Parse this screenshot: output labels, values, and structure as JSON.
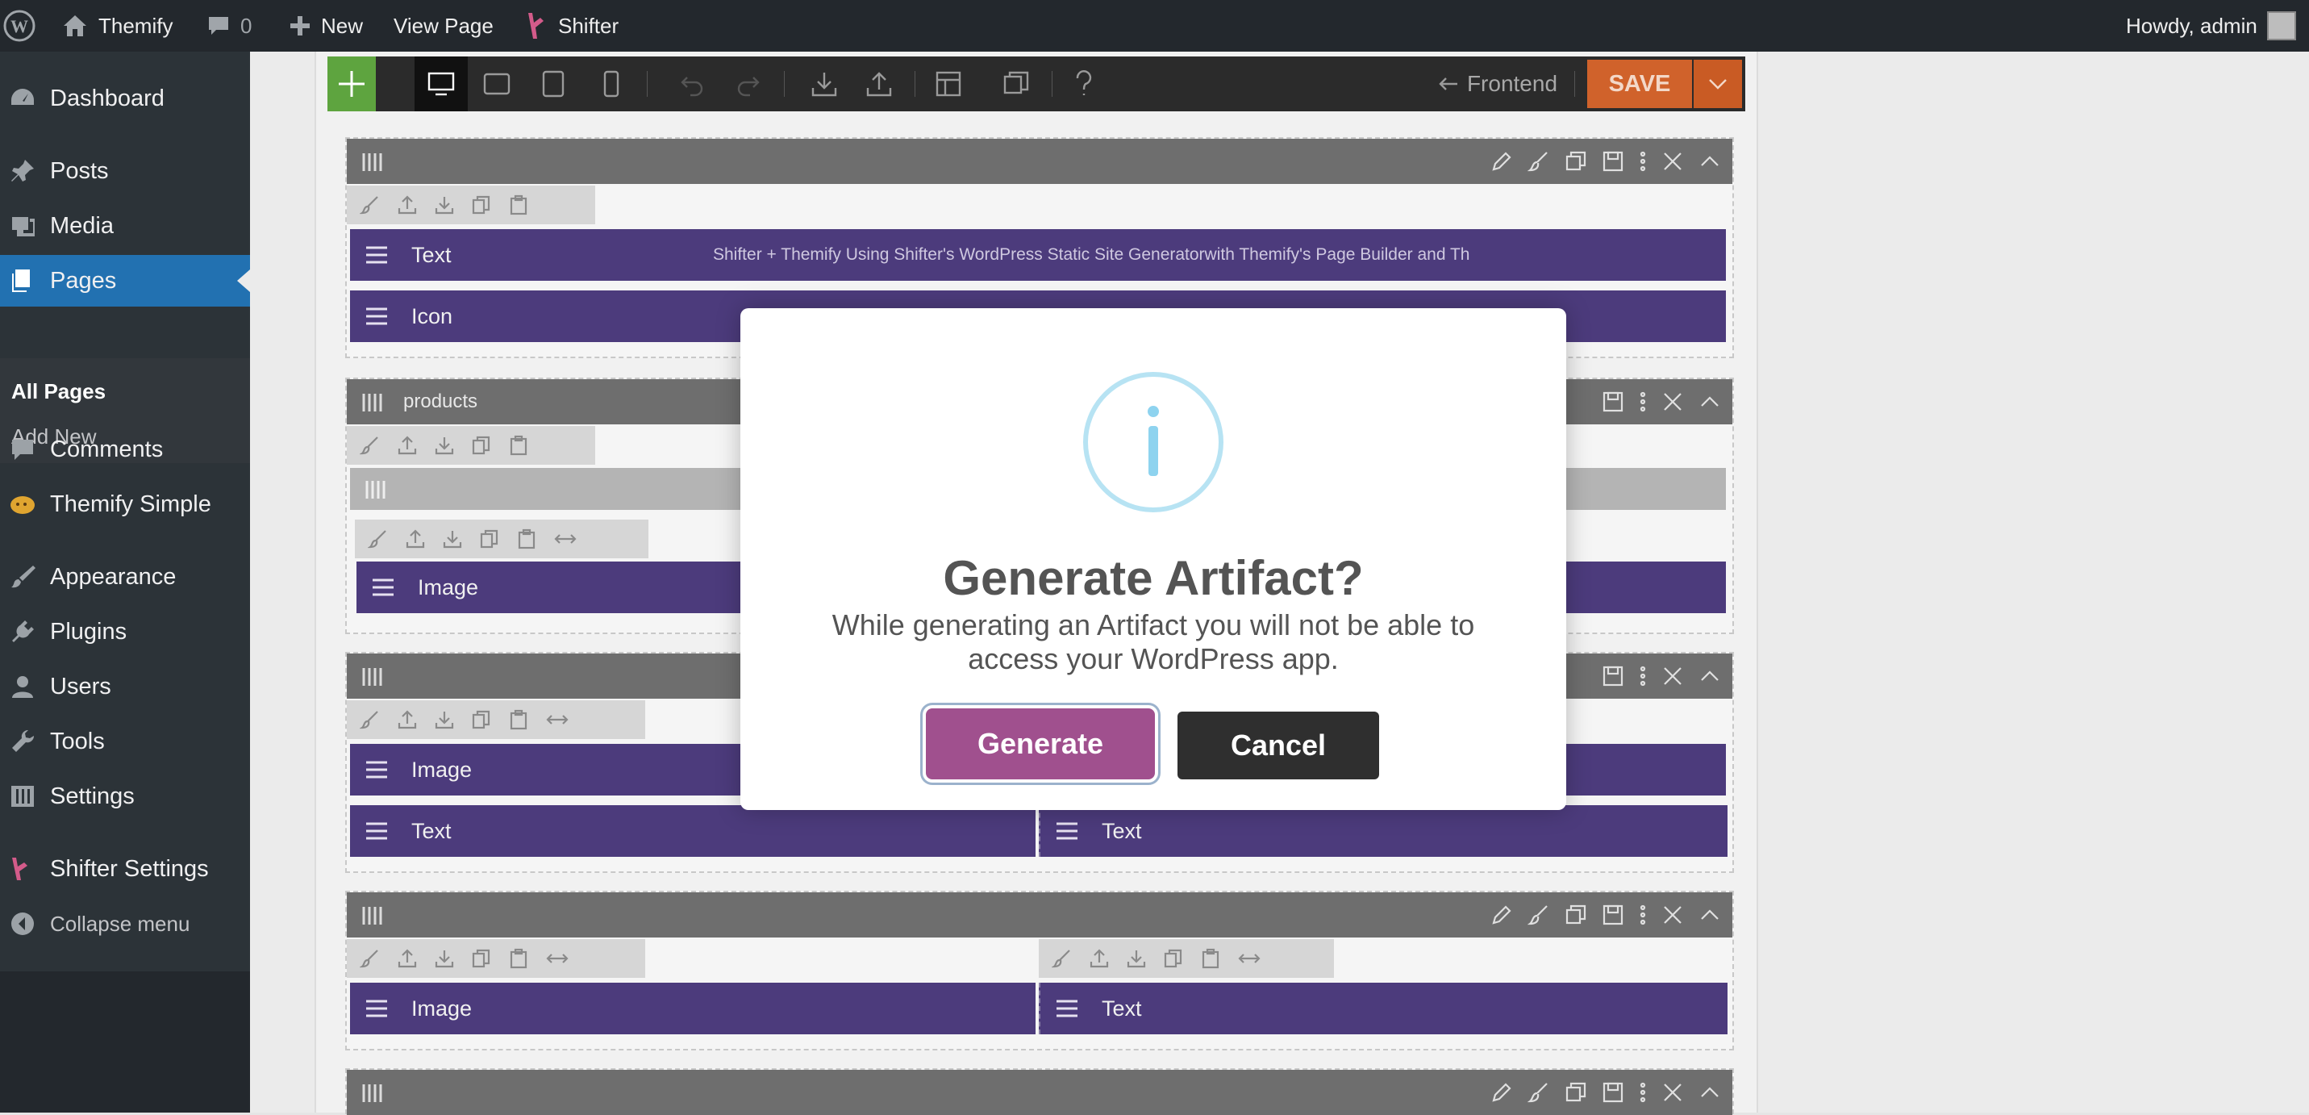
{
  "adminbar": {
    "site_name": "Themify",
    "comments_count": "0",
    "new_label": "New",
    "view_page_label": "View Page",
    "shifter_label": "Shifter",
    "howdy": "Howdy, admin"
  },
  "sidebar": {
    "items": [
      {
        "label": "Dashboard",
        "icon": "dashboard-icon"
      },
      {
        "label": "Posts",
        "icon": "pin-icon"
      },
      {
        "label": "Media",
        "icon": "media-icon"
      },
      {
        "label": "Pages",
        "icon": "pages-icon",
        "current": true
      },
      {
        "label": "Comments",
        "icon": "comment-icon"
      },
      {
        "label": "Themify Simple",
        "icon": "themify-icon"
      },
      {
        "label": "Appearance",
        "icon": "brush-icon"
      },
      {
        "label": "Plugins",
        "icon": "plug-icon"
      },
      {
        "label": "Users",
        "icon": "user-icon"
      },
      {
        "label": "Tools",
        "icon": "wrench-icon"
      },
      {
        "label": "Settings",
        "icon": "sliders-icon"
      },
      {
        "label": "Shifter Settings",
        "icon": "shifter-icon"
      },
      {
        "label": "Collapse menu",
        "icon": "collapse-icon"
      }
    ],
    "submenu": [
      "All Pages",
      "Add New"
    ]
  },
  "toolbar": {
    "frontend_label": "Frontend",
    "save_label": "SAVE"
  },
  "builder": {
    "rows": [
      {
        "label": "",
        "modules": [
          {
            "label": "Text",
            "preview": "Shifter + Themify  Using Shifter's WordPress Static Site Generatorwith Themify's Page Builder and Th"
          },
          {
            "label": "Icon"
          }
        ]
      },
      {
        "label": "products",
        "modules": [
          {
            "label": "Image"
          }
        ]
      },
      {
        "label": "",
        "modules": [
          {
            "label": "Image"
          },
          {
            "label": "Text"
          },
          {
            "label": "Text"
          }
        ]
      },
      {
        "label": "",
        "modules": [
          {
            "label": "Image"
          },
          {
            "label": "Text"
          }
        ]
      }
    ]
  },
  "modal": {
    "icon": "info-icon",
    "title": "Generate Artifact?",
    "text": "While generating an Artifact you will not be able to access your WordPress app.",
    "generate_label": "Generate",
    "cancel_label": "Cancel"
  },
  "colors": {
    "admin_bg": "#23282d",
    "current_menu": "#2271b1",
    "module_purple": "#4c3b7c",
    "save_orange": "#d0622b",
    "add_green": "#5ea43f",
    "generate_purple": "#a0508e",
    "info_blue": "#8ed3ef"
  }
}
